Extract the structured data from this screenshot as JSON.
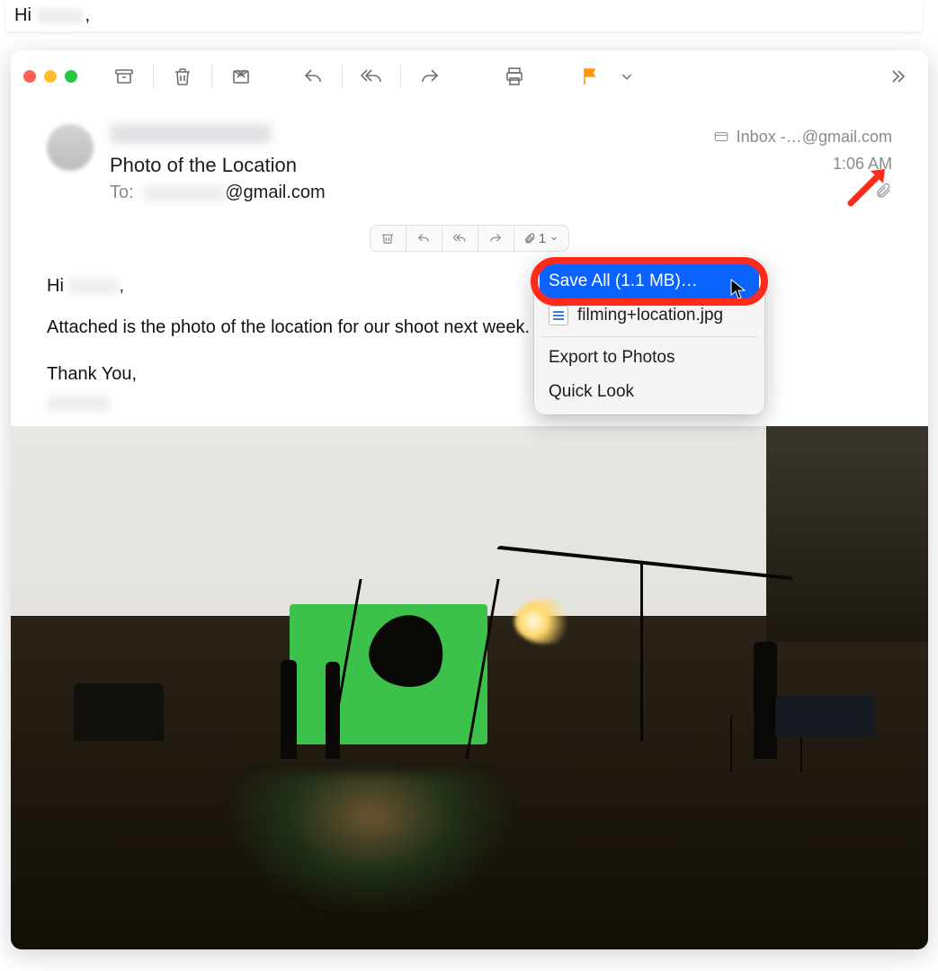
{
  "background": {
    "preview_greeting_prefix": "Hi",
    "preview_greeting_suffix": ","
  },
  "toolbar": {
    "archive": "Archive",
    "trash": "Delete",
    "junk": "Junk",
    "reply": "Reply",
    "reply_all": "Reply All",
    "forward": "Forward",
    "print": "Print",
    "flag": "Flag",
    "flag_menu": "Flag options",
    "overflow": "More"
  },
  "header": {
    "subject": "Photo of the Location",
    "to_label": "To:",
    "to_suffix": "@gmail.com",
    "inbox_label": "Inbox -…@gmail.com",
    "time": "1:06 AM",
    "has_attachment": true
  },
  "inline_actions": {
    "attachment_count": "1"
  },
  "body": {
    "greeting_prefix": "Hi",
    "greeting_suffix": ",",
    "line1": "Attached is the photo of the location for our shoot next week.",
    "closing": "Thank You,"
  },
  "dropdown": {
    "save_all": "Save All (1.1 MB)…",
    "file_name": "filming+location.jpg",
    "export": "Export to Photos",
    "quick_look": "Quick Look"
  }
}
